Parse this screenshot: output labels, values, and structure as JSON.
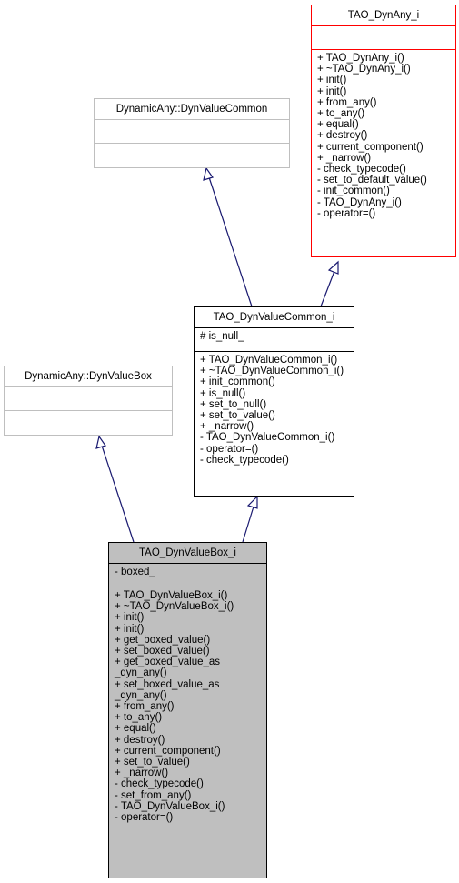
{
  "classes": {
    "tao_dynany_i": {
      "name": "TAO_DynAny_i",
      "attributes": [],
      "methods": [
        "+ TAO_DynAny_i()",
        "+ ~TAO_DynAny_i()",
        "+ init()",
        "+ init()",
        "+ from_any()",
        "+ to_any()",
        "+ equal()",
        "+ destroy()",
        "+ current_component()",
        "+ _narrow()",
        "- check_typecode()",
        "- set_to_default_value()",
        "- init_common()",
        "- TAO_DynAny_i()",
        "- operator=()"
      ]
    },
    "dynvaluecommon": {
      "name": "DynamicAny::DynValueCommon",
      "attributes": [],
      "methods": []
    },
    "tao_dynvaluecommon_i": {
      "name": "TAO_DynValueCommon_i",
      "attributes": [
        "# is_null_"
      ],
      "methods": [
        "+ TAO_DynValueCommon_i()",
        "+ ~TAO_DynValueCommon_i()",
        "+ init_common()",
        "+ is_null()",
        "+ set_to_null()",
        "+ set_to_value()",
        "+ _narrow()",
        "- TAO_DynValueCommon_i()",
        "- operator=()",
        "- check_typecode()"
      ]
    },
    "dynvaluebox": {
      "name": "DynamicAny::DynValueBox",
      "attributes": [],
      "methods": []
    },
    "tao_dynvaluebox_i": {
      "name": "TAO_DynValueBox_i",
      "attributes": [
        "- boxed_"
      ],
      "methods": [
        "+ TAO_DynValueBox_i()",
        "+ ~TAO_DynValueBox_i()",
        "+ init()",
        "+ init()",
        "+ get_boxed_value()",
        "+ set_boxed_value()",
        "+ get_boxed_value_as",
        "_dyn_any()",
        "+ set_boxed_value_as",
        "_dyn_any()",
        "+ from_any()",
        "+ to_any()",
        "+ equal()",
        "+ destroy()",
        "+ current_component()",
        "+ set_to_value()",
        "+ _narrow()",
        "- check_typecode()",
        "- set_from_any()",
        "- TAO_DynValueBox_i()",
        "- operator=()"
      ]
    }
  },
  "edges": [
    {
      "from": "TAO_DynValueCommon_i",
      "to": "DynamicAny::DynValueCommon",
      "type": "inheritance"
    },
    {
      "from": "TAO_DynValueCommon_i",
      "to": "TAO_DynAny_i",
      "type": "inheritance"
    },
    {
      "from": "TAO_DynValueBox_i",
      "to": "DynamicAny::DynValueBox",
      "type": "inheritance"
    },
    {
      "from": "TAO_DynValueBox_i",
      "to": "TAO_DynValueCommon_i",
      "type": "inheritance"
    }
  ],
  "colors": {
    "edge": "#191970",
    "highlight_border": "#ff0000",
    "focus_fill": "#bfbfbf",
    "external_border": "#bfbfbf"
  }
}
